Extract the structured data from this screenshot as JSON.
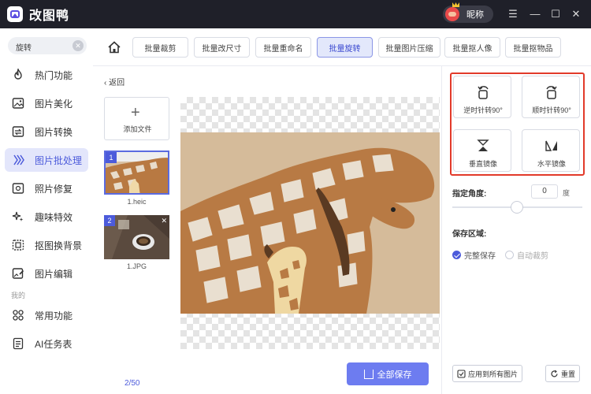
{
  "app": {
    "title": "改图鸭",
    "nickname": "昵称"
  },
  "window_controls": {
    "menu": "☰",
    "minimize": "—",
    "maximize": "☐",
    "close": "✕"
  },
  "sidebar": {
    "search": {
      "value": "旋转",
      "clear": "✕"
    },
    "items": [
      {
        "label": "热门功能",
        "icon": "flame-icon"
      },
      {
        "label": "图片美化",
        "icon": "image-beauty-icon"
      },
      {
        "label": "图片转换",
        "icon": "image-convert-icon"
      },
      {
        "label": "图片批处理",
        "icon": "batch-process-icon",
        "active": true
      },
      {
        "label": "照片修复",
        "icon": "photo-repair-icon"
      },
      {
        "label": "趣味特效",
        "icon": "sparkle-icon"
      },
      {
        "label": "抠图换背景",
        "icon": "cutout-icon"
      },
      {
        "label": "图片编辑",
        "icon": "image-edit-icon"
      }
    ],
    "group_label": "我的",
    "my_items": [
      {
        "label": "常用功能",
        "icon": "grid-icon"
      },
      {
        "label": "AI任务表",
        "icon": "task-list-icon"
      }
    ]
  },
  "toolbar": {
    "tabs": [
      "批量裁剪",
      "批量改尺寸",
      "批量重命名",
      "批量旋转",
      "批量图片压缩",
      "批量抠人像",
      "批量抠物品"
    ],
    "active_tab": "批量旋转"
  },
  "workspace": {
    "back": "返回",
    "add_file": {
      "plus": "+",
      "label": "添加文件"
    },
    "files": [
      {
        "num": "1",
        "name": "1.heic",
        "selected": true
      },
      {
        "num": "2",
        "name": "1.JPG",
        "close": "✕"
      }
    ],
    "page_count": "2/50",
    "save_all": "全部保存"
  },
  "panel": {
    "rotate_left": "逆时针转90°",
    "rotate_right": "顺时针转90°",
    "flip_vertical": "垂直镜像",
    "flip_horizontal": "水平镜像",
    "angle_label": "指定角度:",
    "angle_value": "0",
    "angle_unit": "度",
    "angle_slider": 0.5,
    "save_area_label": "保存区域:",
    "save_full": "完整保存",
    "save_auto": "自动裁剪",
    "apply_all": "应用到所有图片",
    "reset": "重置"
  },
  "colors": {
    "accent": "#4c5bdb",
    "highlight": "#e23a2a",
    "titlebar": "#1f2029"
  }
}
